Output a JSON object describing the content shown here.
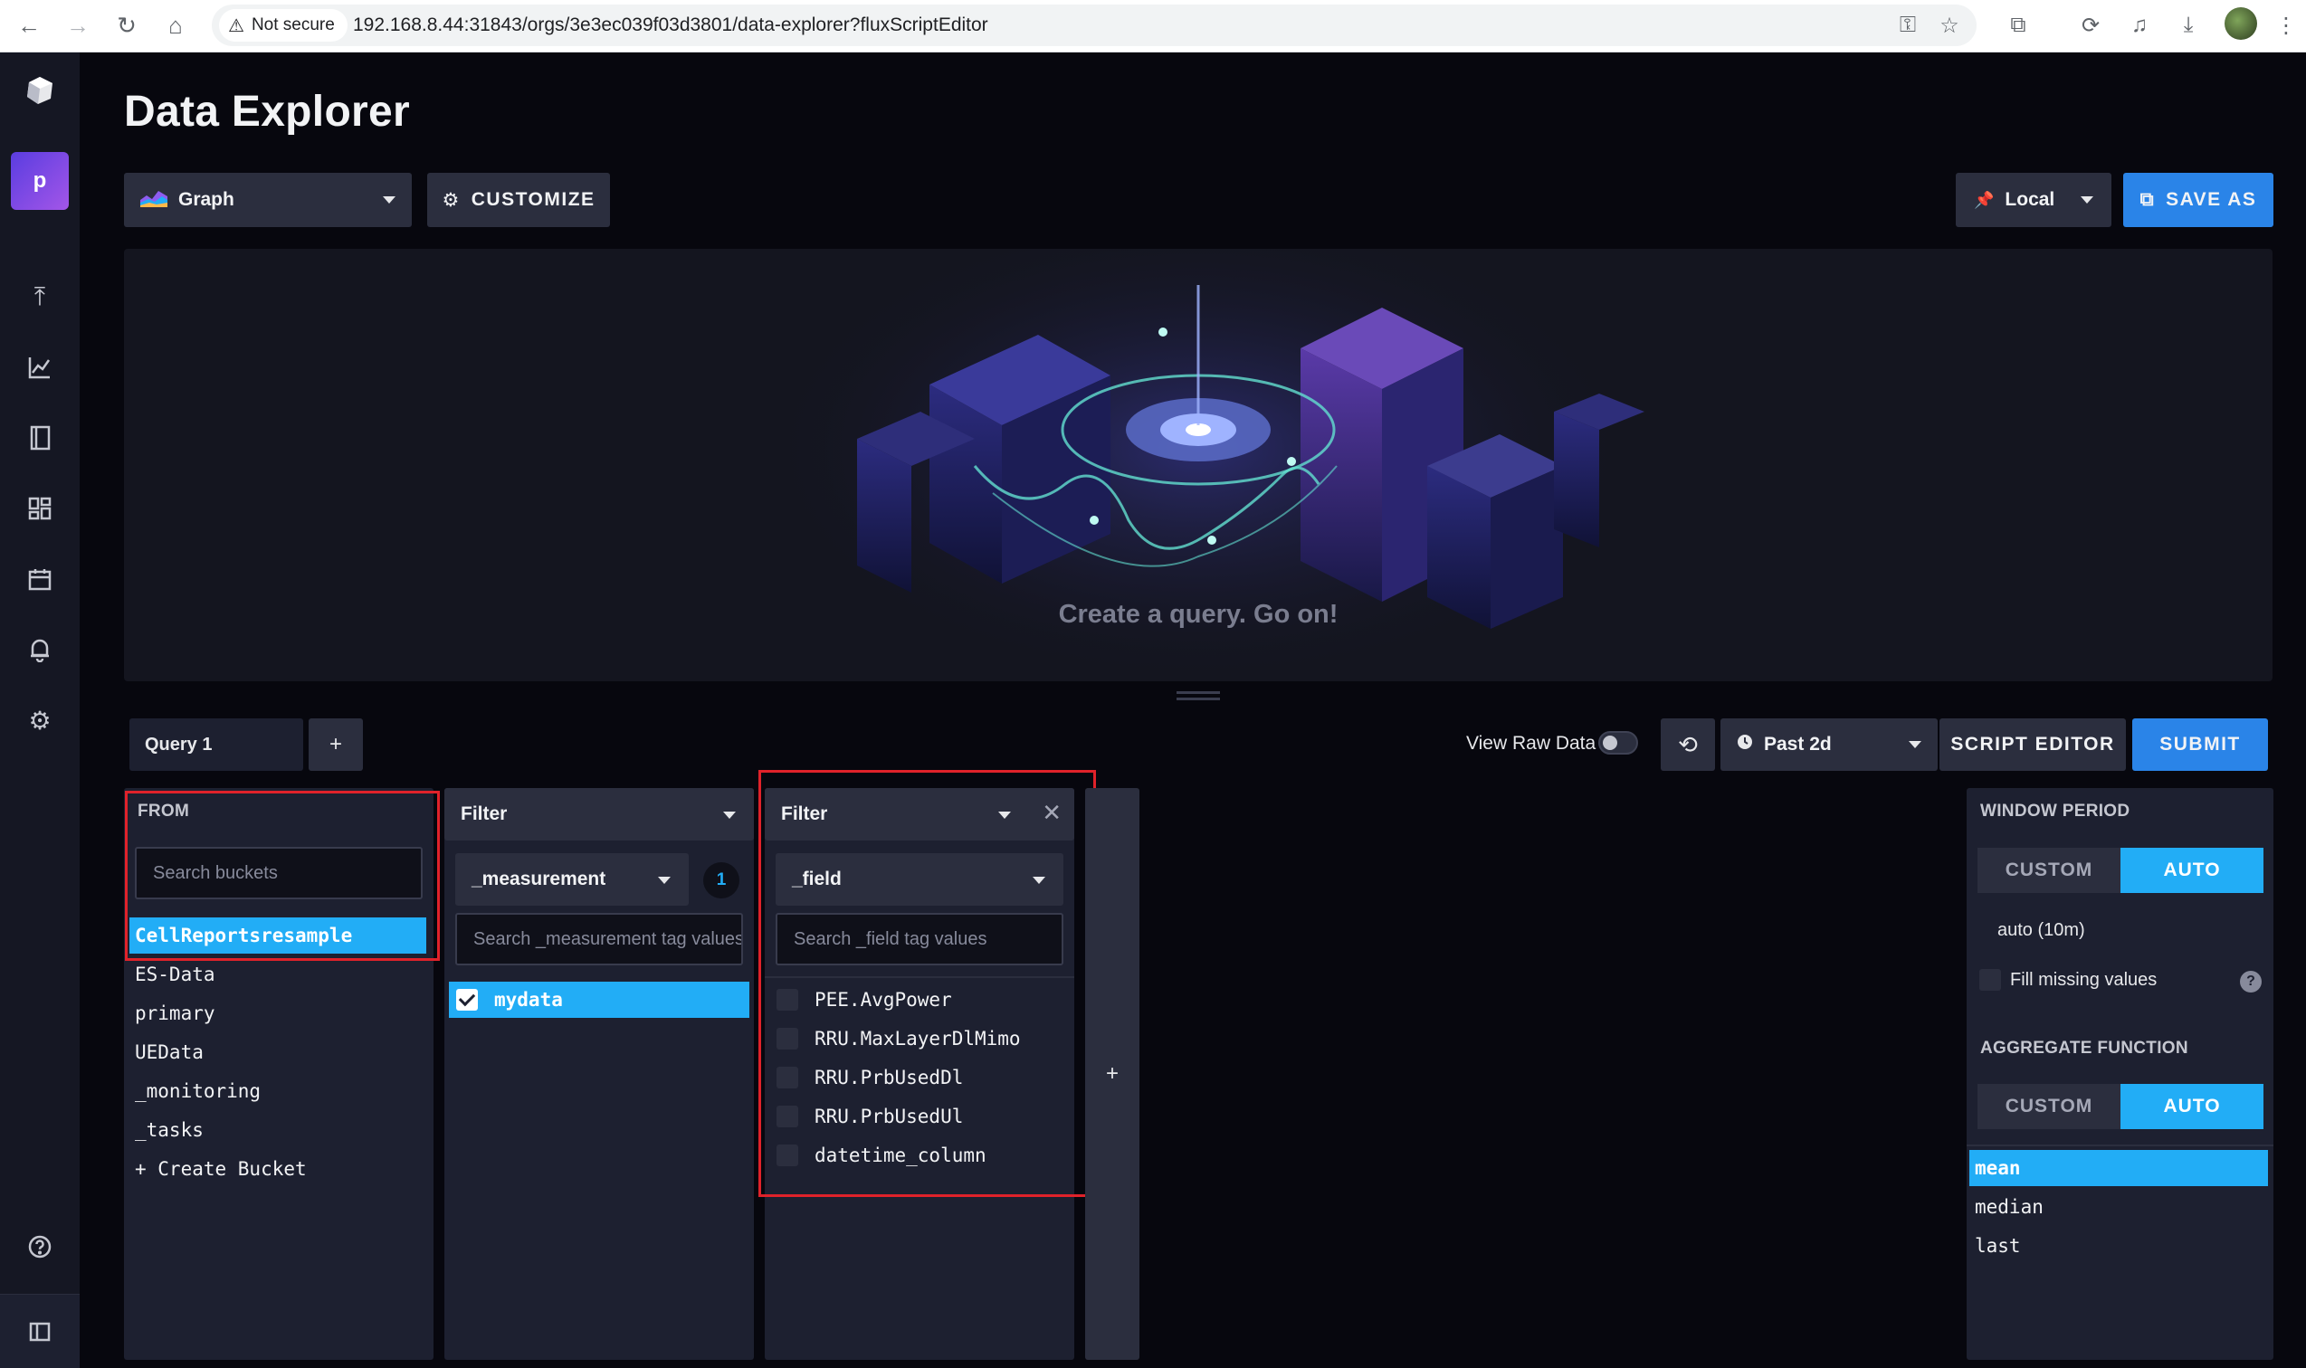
{
  "browser": {
    "security_label": "Not secure",
    "url": "192.168.8.44:31843/orgs/3e3ec039f03d3801/data-explorer?fluxScriptEditor"
  },
  "sidebar": {
    "org_initial": "p"
  },
  "header": {
    "title": "Data Explorer",
    "vis_type_label": "Graph",
    "customize_label": "CUSTOMIZE",
    "timezone_label": "Local",
    "save_as_label": "SAVE AS"
  },
  "visualization": {
    "empty_message": "Create a query. Go on!"
  },
  "query_bar": {
    "tab_label": "Query 1",
    "add_label": "+",
    "view_raw_label": "View Raw Data",
    "view_raw_enabled": false,
    "time_range_label": "Past 2d",
    "script_editor_label": "SCRIPT EDITOR",
    "submit_label": "SUBMIT"
  },
  "from_panel": {
    "header": "FROM",
    "search_placeholder": "Search buckets",
    "buckets": [
      "CellReportsresample",
      "ES-Data",
      "primary",
      "UEData",
      "_monitoring",
      "_tasks",
      "+ Create Bucket"
    ],
    "selected_bucket": "CellReportsresample"
  },
  "filter_panel_1": {
    "function_label": "Filter",
    "key_label": "_measurement",
    "selected_count": "1",
    "search_placeholder": "Search _measurement tag values",
    "values": [
      {
        "label": "mydata",
        "checked": true
      }
    ]
  },
  "filter_panel_2": {
    "function_label": "Filter",
    "key_label": "_field",
    "search_placeholder": "Search _field tag values",
    "values": [
      {
        "label": "PEE.AvgPower",
        "checked": false
      },
      {
        "label": "RRU.MaxLayerDlMimo",
        "checked": false
      },
      {
        "label": "RRU.PrbUsedDl",
        "checked": false
      },
      {
        "label": "RRU.PrbUsedUl",
        "checked": false
      },
      {
        "label": "datetime_column",
        "checked": false
      }
    ]
  },
  "add_filter_label": "+",
  "aggregate_panel": {
    "window_period_label": "WINDOW PERIOD",
    "custom_label": "CUSTOM",
    "auto_label": "AUTO",
    "window_value": "auto (10m)",
    "fill_missing_label": "Fill missing values",
    "help_label": "?",
    "aggregate_function_label": "AGGREGATE FUNCTION",
    "functions": [
      "mean",
      "median",
      "last"
    ],
    "selected_function": "mean"
  },
  "colors": {
    "accent_blue": "#22adf6",
    "highlight_red": "#e0222a",
    "panel_bg": "#1d2030"
  }
}
